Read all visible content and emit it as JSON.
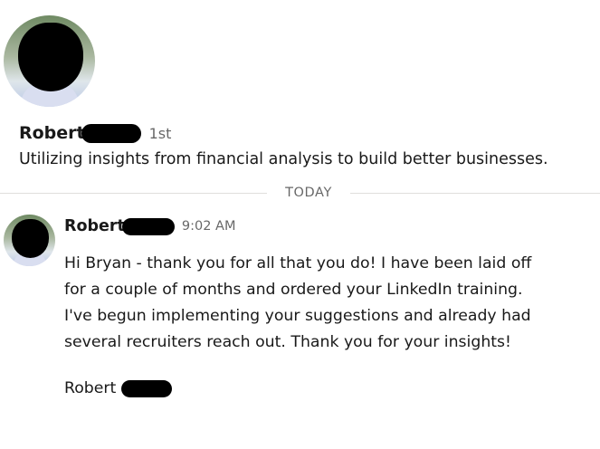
{
  "profile": {
    "name": "Robert",
    "name_redacted": true,
    "connection_degree": "1st",
    "headline": "Utilizing insights from financial analysis to build better businesses."
  },
  "conversation": {
    "date_divider": "TODAY",
    "messages": [
      {
        "sender": "Robert",
        "sender_redacted": true,
        "time": "9:02 AM",
        "body_lines": [
          "Hi Bryan - thank you for all that you do! I have been laid off",
          "for a couple of months and ordered your LinkedIn training.",
          "I've begun implementing your suggestions and already had",
          "several recruiters reach out. Thank you for your insights!"
        ],
        "signature": "Robert",
        "signature_redacted": true
      }
    ]
  },
  "colors": {
    "text_primary": "#191919",
    "text_secondary": "#666666",
    "divider": "#e0dfdc",
    "redaction": "#000000"
  }
}
